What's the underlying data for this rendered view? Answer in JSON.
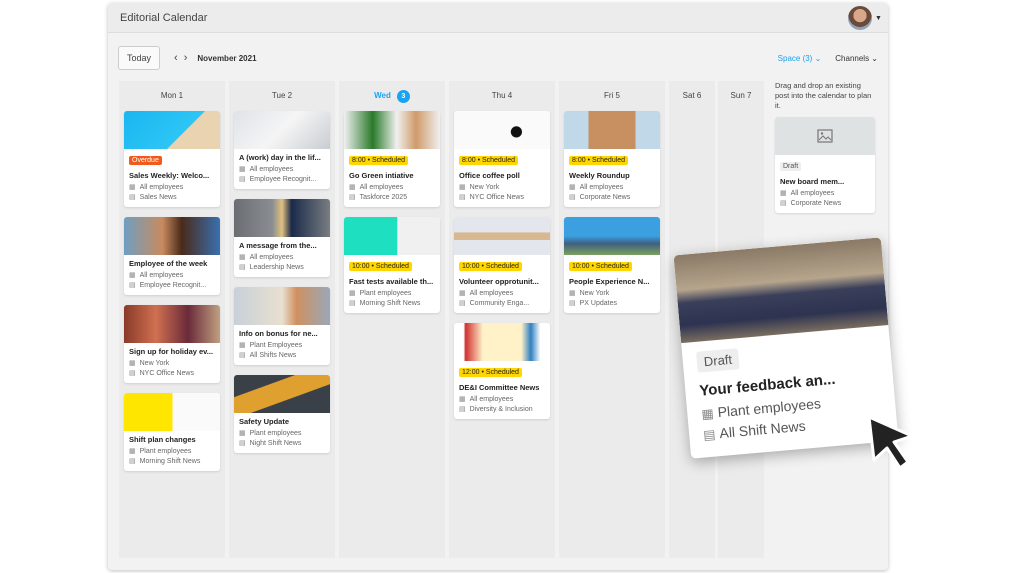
{
  "window": {
    "title": "Editorial Calendar"
  },
  "toolbar": {
    "today": "Today",
    "prev": "‹",
    "next": "›",
    "month": "November 2021",
    "space": "Space (3) ⌄",
    "channels": "Channels ⌄"
  },
  "icons": {
    "audience": "audience-icon",
    "channel": "newspaper-icon",
    "image": "image-placeholder-icon"
  },
  "colors": {
    "accent": "#1aa3f0",
    "overdue": "#f05a1a",
    "scheduled": "#ffd600"
  },
  "days": [
    {
      "label": "Mon 1",
      "today": false,
      "cards": [
        {
          "status": "Overdue",
          "type": "overdue",
          "title": "Sales Weekly: Welco...",
          "audience": "All employees",
          "channel": "Sales News",
          "img": "linear-gradient(135deg,#19b6f0,#2ec5f5 60%,#e9d3b0 61%)"
        },
        {
          "title": "Employee of the week",
          "audience": "All employees",
          "channel": "Employee Recognit...",
          "img": "linear-gradient(90deg,#6f9fc0,#c88a60 40%,#4a2a1a 60%,#3a6fb0)"
        },
        {
          "title": "Sign up for holiday ev...",
          "audience": "New York",
          "channel": "NYC Office News",
          "img": "linear-gradient(90deg,#8a3a2a,#d07050,#6a2a3a,#c0a080)"
        },
        {
          "title": "Shift plan changes",
          "audience": "Plant employees",
          "channel": "Morning Shift News",
          "img": "linear-gradient(90deg,#ffe600 50%,#fafafa 51%)"
        }
      ]
    },
    {
      "label": "Tue 2",
      "today": false,
      "cards": [
        {
          "title": "A (work) day in the lif...",
          "audience": "All employees",
          "channel": "Employee Recognit...",
          "img": "linear-gradient(135deg,#dfe3e8,#f5f5f5 50%,#c8ccd2)"
        },
        {
          "title": "A message from the...",
          "audience": "All employees",
          "channel": "Leadership News",
          "img": "linear-gradient(90deg,#6a6e72,#8a8e92 40%,#e0c080 50%,#1a2a4a 60%,#7a7e82)"
        },
        {
          "title": "Info on bonus for ne...",
          "audience": "Plant Employees",
          "channel": "All Shifts News",
          "img": "linear-gradient(90deg,#c8d0d8,#e8e0d0 50%,#d09060 65%,#9aa8b8)"
        },
        {
          "title": "Safety Update",
          "audience": "Plant employees",
          "channel": "Night Shift News",
          "img": "linear-gradient(160deg,#3a4048 30%,#e0a030 31% 60%,#3a4048 61%)"
        }
      ]
    },
    {
      "label": "Wed",
      "badge": "3",
      "today": true,
      "cards": [
        {
          "status": "8:00 • Scheduled",
          "type": "sched",
          "title": "Go Green intiative",
          "audience": "All employees",
          "channel": "Taskforce 2025",
          "img": "linear-gradient(90deg,#f0f0f0,#2a7a2a 30%,#f0f0f0 55%,#d09a6a 75%,#f0f0f0)"
        },
        {
          "status": "10:00 • Scheduled",
          "type": "sched",
          "title": "Fast tests available th...",
          "audience": "Plant employees",
          "channel": "Morning Shift News",
          "img": "linear-gradient(90deg,#1ee0c0 55%,#f0f0f0 56%)"
        }
      ]
    },
    {
      "label": "Thu 4",
      "today": false,
      "cards": [
        {
          "status": "8:00 • Scheduled",
          "type": "sched",
          "title": "Office coffee poll",
          "audience": "New York",
          "channel": "NYC Office News",
          "img": "radial-gradient(circle at 65% 55%,#111 0 8%,#fafafa 9%)"
        },
        {
          "status": "10:00 • Scheduled",
          "type": "sched",
          "title": "Volunteer opprotunit...",
          "audience": "All employees",
          "channel": "Community Enga...",
          "img": "linear-gradient(180deg,#e4e6ee 40%,#d8b890 41% 60%,#e4e6ee 61%)"
        },
        {
          "status": "12:00 • Scheduled",
          "type": "sched",
          "title": "DE&I Committee News",
          "audience": "All employees",
          "channel": "Diversity & Inclusion",
          "img": "linear-gradient(90deg,#fff 10%,#d03030 12%,#fff1c8 30% 70%,#3080c0 80%,#fff 90%)"
        }
      ]
    },
    {
      "label": "Fri 5",
      "today": false,
      "cards": [
        {
          "status": "8:00 • Scheduled",
          "type": "sched",
          "title": "Weekly Roundup",
          "audience": "All employees",
          "channel": "Corporate News",
          "img": "linear-gradient(90deg,#c0d8e8 25%,#c89060 26% 74%,#c0d8e8 75%)"
        },
        {
          "status": "10:00 • Scheduled",
          "type": "sched",
          "title": "People Experience N...",
          "audience": "New York",
          "channel": "PX Updates",
          "img": "linear-gradient(180deg,#3aa0e0 50%,#406080 70%,#7aa060)"
        }
      ]
    },
    {
      "label": "Sat 6",
      "today": false,
      "cards": []
    },
    {
      "label": "Sun 7",
      "today": false,
      "cards": []
    }
  ],
  "side": {
    "hint": "Drag and drop an existing post into the calendar to plan it.",
    "card": {
      "status": "Draft",
      "title": "New board mem...",
      "audience": "All employees",
      "channel": "Corporate News"
    }
  },
  "drag_card": {
    "status": "Draft",
    "title": "Your feedback an...",
    "audience": "Plant employees",
    "channel": "All Shift News"
  }
}
